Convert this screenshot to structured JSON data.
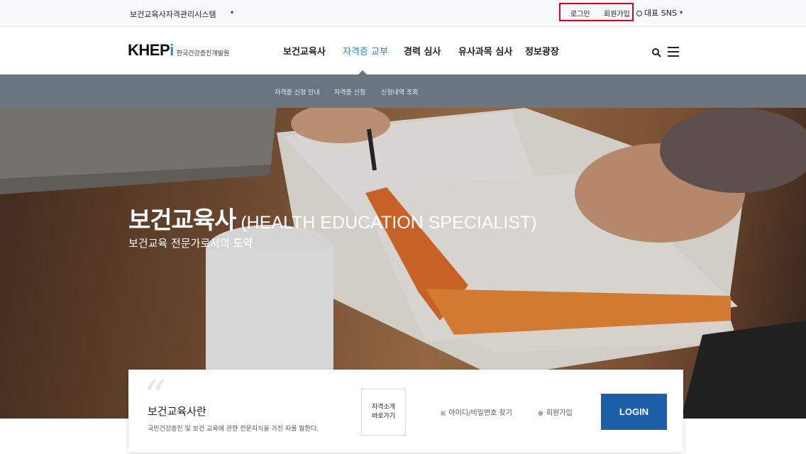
{
  "utility_bar": {
    "system_select": "보건교육사자격관리시스템",
    "login": "로그인",
    "join": "회원가입",
    "sns": "대표 SNS",
    "caret": "▾"
  },
  "header": {
    "logo_mark": "KHEP",
    "logo_mark_i": "i",
    "logo_sub": "한국건강증진개발원",
    "nav": [
      "보건교육사",
      "자격증 교부",
      "경력 심사",
      "유사과목 심사",
      "정보광장"
    ],
    "active_nav_index": 1
  },
  "subnav": [
    "자격증 신청 안내",
    "자격증 신청",
    "신청내역 조회"
  ],
  "hero": {
    "title_kr": "보건교육사",
    "title_en": " (HEALTH EDUCATION SPECIALIST)",
    "subtitle_pre": "보건교육 전문가로서의 ",
    "subtitle_bold": "도약"
  },
  "card": {
    "quote_mark": "“",
    "title": "보건교육사란",
    "desc": "국민건강증진 및 보건 교육에 관한 전문지식을 가진 자를 말한다.",
    "shortcut_line1": "자격소개",
    "shortcut_line2": "바로가기",
    "find_label": "아이디/비밀번호 찾기",
    "signup_label": "회원가입",
    "login_button": "LOGIN"
  },
  "colors": {
    "accent": "#2a84c6",
    "subnav_bg": "#6b7580",
    "login_button": "#1c5ea8",
    "highlight_box": "#e2001a"
  }
}
